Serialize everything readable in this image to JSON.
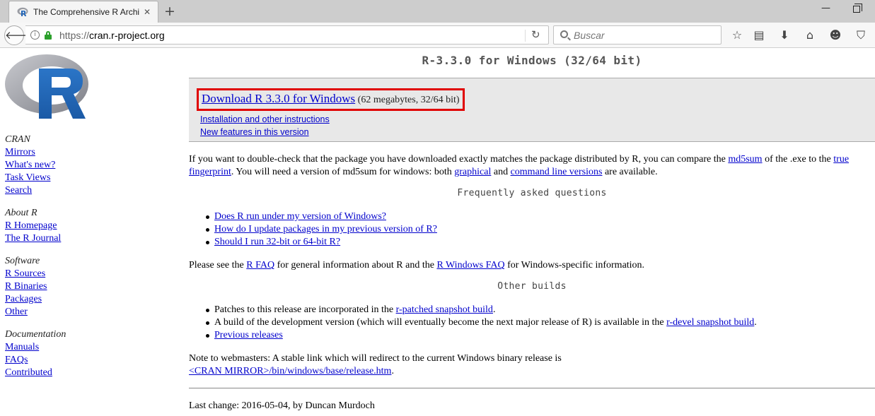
{
  "browser": {
    "tab_title": "The Comprehensive R Archive Network",
    "url_host": "cran.r-project.org",
    "url_scheme": "https://",
    "search_placeholder": "Buscar"
  },
  "sidebar": {
    "groups": [
      {
        "heading": "CRAN",
        "links": [
          "Mirrors",
          "What's new?",
          "Task Views",
          "Search"
        ]
      },
      {
        "heading": "About R",
        "links": [
          "R Homepage",
          "The R Journal"
        ]
      },
      {
        "heading": "Software",
        "links": [
          "R Sources",
          "R Binaries",
          "Packages",
          "Other"
        ]
      },
      {
        "heading": "Documentation",
        "links": [
          "Manuals",
          "FAQs",
          "Contributed"
        ]
      }
    ]
  },
  "main": {
    "title": "R-3.3.0 for Windows (32/64 bit)",
    "download": {
      "label": "Download R 3.3.0 for Windows",
      "size": "(62 megabytes, 32/64 bit)",
      "install_link": "Installation and other instructions",
      "features_link": "New features in this version"
    },
    "md5": {
      "t1": "If you want to double-check that the package you have downloaded exactly matches the package distributed by R, you can compare the ",
      "link_md5": "md5sum",
      "t2": " of the .exe to the ",
      "link_true": "true",
      "link_fingerprint": "fingerprint",
      "t3": ". You will need a version of md5sum for windows: both ",
      "link_graphical": "graphical",
      "t4": " and ",
      "link_cmdline": "command line versions",
      "t5": " are available."
    },
    "faq": {
      "heading": "Frequently asked questions",
      "items": [
        "Does R run under my version of Windows?",
        "How do I update packages in my previous version of R?",
        "Should I run 32-bit or 64-bit R?"
      ]
    },
    "rfaq": {
      "t1": "Please see the ",
      "link_rfaq": "R FAQ",
      "t2": " for general information about R and the ",
      "link_rwfaq": "R Windows FAQ",
      "t3": " for Windows-specific information."
    },
    "other_builds": {
      "heading": "Other builds",
      "b1_text": "Patches to this release are incorporated in the ",
      "b1_link": "r-patched snapshot build",
      "b1_end": ".",
      "b2_text": "A build of the development version (which will eventually become the next major release of R) is available in the ",
      "b2_link": "r-devel snapshot build",
      "b2_end": ".",
      "b3_link": "Previous releases"
    },
    "webmasters": {
      "text": "Note to webmasters: A stable link which will redirect to the current Windows binary release is",
      "link": "<CRAN MIRROR>/bin/windows/base/release.htm",
      "end": "."
    },
    "last_change": "Last change: 2016-05-04, by Duncan Murdoch"
  }
}
